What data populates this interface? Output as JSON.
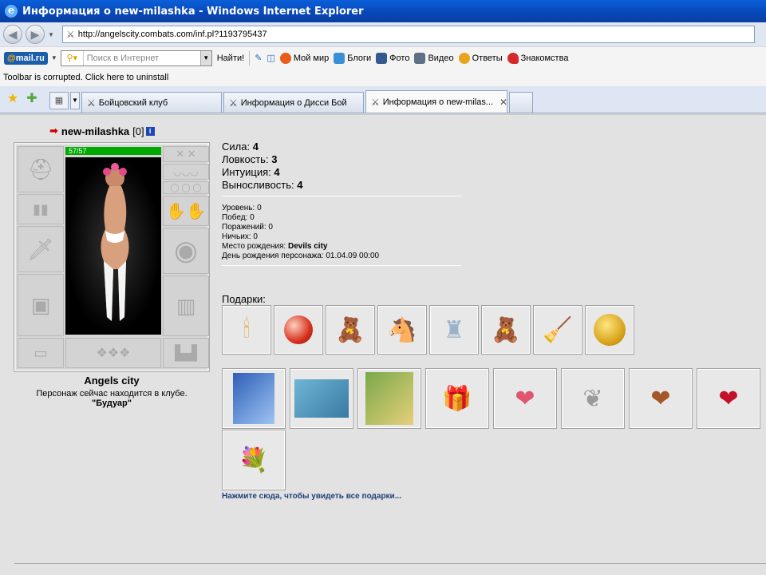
{
  "window": {
    "title": "Информация о new-milashka - Windows Internet Explorer",
    "icon": "ie-logo-icon"
  },
  "address": {
    "url": "http://angelscity.combats.com/inf.pl?1193795437"
  },
  "mail_toolbar": {
    "logo": "@mail.ru",
    "search_placeholder": "Поиск в Интернет",
    "search_button": "Найти!",
    "links": [
      "Мой мир",
      "Блоги",
      "Фото",
      "Видео",
      "Ответы",
      "Знакомства"
    ]
  },
  "notice": "Toolbar is corrupted. Click here to uninstall",
  "tabs": [
    {
      "label": "Бойцовский клуб",
      "active": false
    },
    {
      "label": "Информация о Дисси Бой",
      "active": false
    },
    {
      "label": "Информация о new-milas...",
      "active": true
    }
  ],
  "character": {
    "nick": "new-milashka",
    "level_badge": "[0]",
    "hp": "57/57",
    "hp_fraction": 1.0,
    "city": "Angels city",
    "location_text": "Персонаж сейчас находится в клубе.",
    "room": "\"Будуар\""
  },
  "stats": [
    {
      "label": "Сила:",
      "value": "4"
    },
    {
      "label": "Ловкость:",
      "value": "3"
    },
    {
      "label": "Интуиция:",
      "value": "4"
    },
    {
      "label": "Выносливость:",
      "value": "4"
    }
  ],
  "info": {
    "level": "Уровень: 0",
    "wins": "Побед: 0",
    "losses": "Поражений: 0",
    "draws": "Ничьих: 0",
    "birthplace_label": "Место рождения:",
    "birthplace": "Devils city",
    "birthday": "День рождения персонажа: 01.04.09 00:00"
  },
  "gifts": {
    "label": "Подарки:",
    "row1": [
      "candle",
      "crystal-ball",
      "teddy-bear",
      "rocking-horse",
      "statue",
      "teddy-bear",
      "broom",
      "gold-coin"
    ],
    "row2": [
      "card-2009-blue",
      "card-2009-envelope",
      "card-2009-tree",
      "gift-box",
      "heart-pink",
      "heart-silver",
      "chocolate-heart",
      "heart-love-you"
    ],
    "row3": [
      "flower-basket"
    ],
    "see_all": "Нажмите сюда, чтобы увидеть все подарки..."
  }
}
